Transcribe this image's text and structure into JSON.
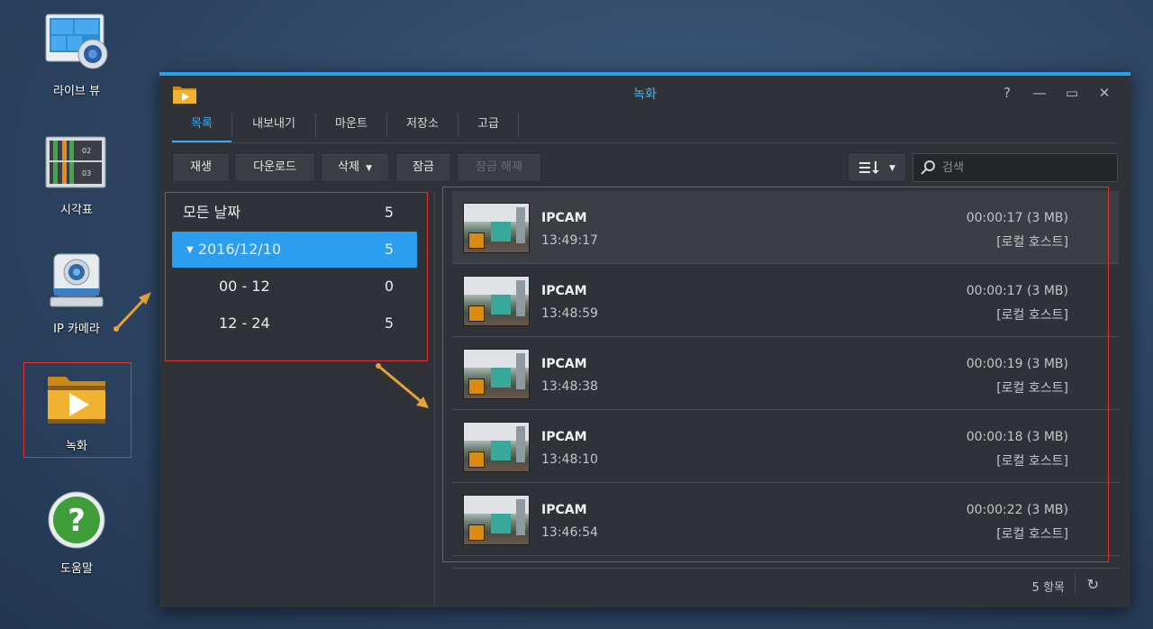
{
  "desktop": {
    "icons": [
      {
        "label": "라이브 뷰"
      },
      {
        "label": "시각표"
      },
      {
        "label": "IP 카메라"
      },
      {
        "label": "녹화"
      },
      {
        "label": "도움말"
      }
    ]
  },
  "window": {
    "title": "녹화",
    "controls": {
      "help": "?",
      "minimize": "—",
      "maximize": "▭",
      "close": "✕"
    },
    "tabs": [
      {
        "label": "목록"
      },
      {
        "label": "내보내기"
      },
      {
        "label": "마운트"
      },
      {
        "label": "저장소"
      },
      {
        "label": "고급"
      }
    ],
    "toolbar": {
      "play": "재생",
      "download": "다운로드",
      "delete": "삭제",
      "lock": "잠금",
      "unlock": "잠금 해제",
      "sort_icon": "sort-icon"
    },
    "search": {
      "placeholder": "검색"
    },
    "tree": [
      {
        "label": "모든 날짜",
        "count": "5"
      },
      {
        "label": "2016/12/10",
        "count": "5"
      },
      {
        "label": "00 - 12",
        "count": "0"
      },
      {
        "label": "12 - 24",
        "count": "5"
      }
    ],
    "recordings": [
      {
        "camera": "IPCAM",
        "time": "13:49:17",
        "duration": "00:00:17 (3 MB)",
        "host": "[로컬 호스트]"
      },
      {
        "camera": "IPCAM",
        "time": "13:48:59",
        "duration": "00:00:17 (3 MB)",
        "host": "[로컬 호스트]"
      },
      {
        "camera": "IPCAM",
        "time": "13:48:38",
        "duration": "00:00:19 (3 MB)",
        "host": "[로컬 호스트]"
      },
      {
        "camera": "IPCAM",
        "time": "13:48:10",
        "duration": "00:00:18 (3 MB)",
        "host": "[로컬 호스트]"
      },
      {
        "camera": "IPCAM",
        "time": "13:46:54",
        "duration": "00:00:22 (3 MB)",
        "host": "[로컬 호스트]"
      }
    ],
    "footer": {
      "count_label": "5 항목"
    }
  },
  "colors": {
    "accent": "#2c9ef0",
    "highlight": "#e53030",
    "arrow": "#e8a23a",
    "badge": "#d98b12"
  }
}
